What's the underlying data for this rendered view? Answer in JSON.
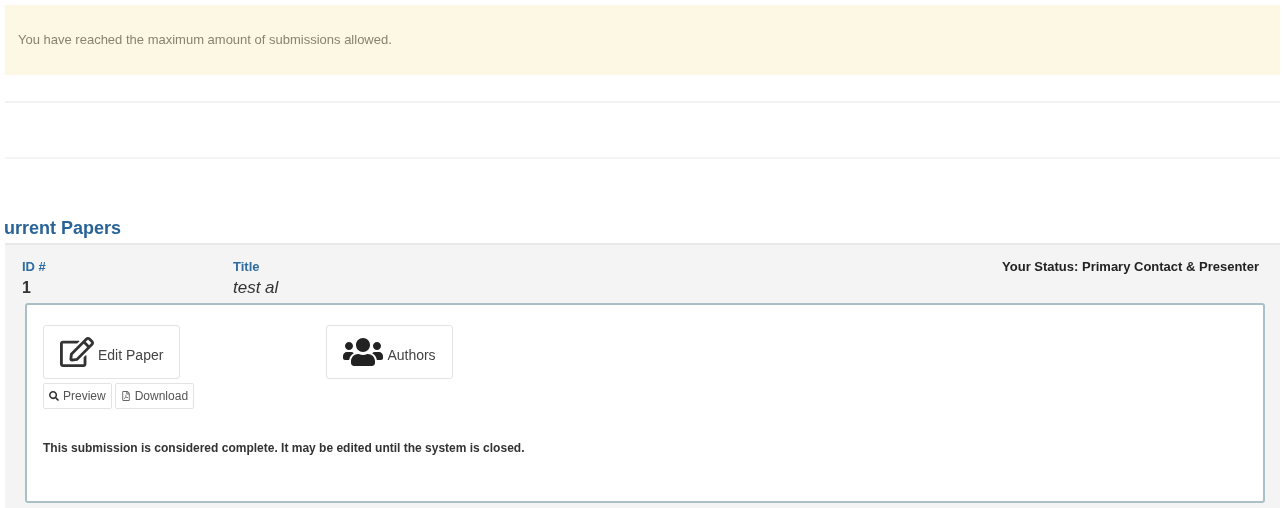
{
  "alert": {
    "message": "You have reached the maximum amount of submissions allowed."
  },
  "section": {
    "heading": "urrent Papers"
  },
  "paper": {
    "id_label": "ID #",
    "id": "1",
    "title_label": "Title",
    "title": "test al",
    "status": "Your Status: Primary Contact & Presenter",
    "buttons": [
      {
        "label": "Edit Paper",
        "kind": "edit"
      },
      {
        "label": "Authors",
        "kind": "authors"
      }
    ],
    "small_buttons": [
      {
        "label": "Preview",
        "kind": "preview"
      },
      {
        "label": "Download",
        "kind": "download"
      }
    ],
    "note": "This submission is considered complete. It may be edited until the system is closed."
  }
}
